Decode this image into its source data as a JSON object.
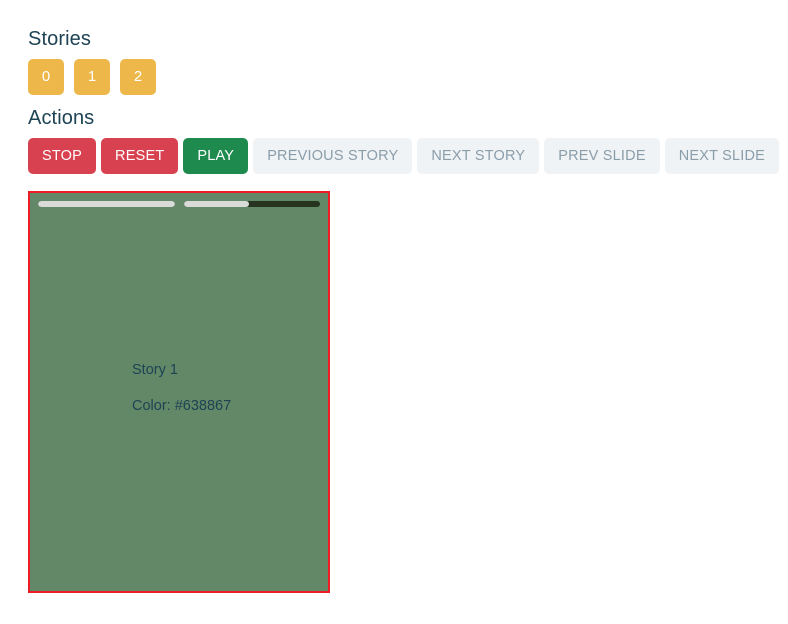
{
  "stories_section": {
    "heading": "Stories",
    "chips": [
      {
        "label": "0"
      },
      {
        "label": "1"
      },
      {
        "label": "2"
      }
    ]
  },
  "actions_section": {
    "heading": "Actions",
    "buttons": [
      {
        "label": "STOP",
        "style": "danger"
      },
      {
        "label": "RESET",
        "style": "danger"
      },
      {
        "label": "PLAY",
        "style": "success"
      },
      {
        "label": "PREVIOUS STORY",
        "style": "neutral"
      },
      {
        "label": "NEXT STORY",
        "style": "neutral"
      },
      {
        "label": "PREV SLIDE",
        "style": "neutral"
      },
      {
        "label": "NEXT SLIDE",
        "style": "neutral"
      }
    ]
  },
  "story_viewer": {
    "background_color": "#638867",
    "border_color": "#ef1c25",
    "progress": [
      {
        "percent": 100
      },
      {
        "percent": 48
      }
    ],
    "title": "Story 1",
    "color_text": "Color: #638867"
  },
  "colors": {
    "heading": "#1d4354",
    "chip": "#edb74a",
    "danger": "#d8414f",
    "success": "#1e8a4e",
    "neutral_bg": "#f0f3f5",
    "neutral_text": "#8a9daa",
    "progress_fill": "#d8dbd8",
    "progress_track": "#26331f"
  }
}
